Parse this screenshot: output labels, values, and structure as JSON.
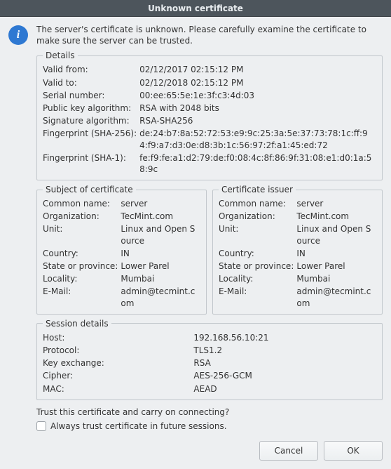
{
  "title": "Unknown certificate",
  "message": "The server's certificate is unknown. Please carefully examine the certificate to make sure the server can be trusted.",
  "details": {
    "legend": "Details",
    "valid_from_label": "Valid from:",
    "valid_from": "02/12/2017 02:15:12 PM",
    "valid_to_label": "Valid to:",
    "valid_to": "02/12/2018 02:15:12 PM",
    "serial_label": "Serial number:",
    "serial": "00:ee:65:5e:1e:3f:c3:4d:03",
    "pubkey_label": "Public key algorithm:",
    "pubkey": "RSA with 2048 bits",
    "sigalg_label": "Signature algorithm:",
    "sigalg": "RSA-SHA256",
    "fp256_label": "Fingerprint (SHA-256):",
    "fp256": "de:24:b7:8a:52:72:53:e9:9c:25:3a:5e:37:73:78:1c:ff:94:f9:a7:d3:0e:d8:3b:1c:56:97:2f:a1:45:ed:72",
    "fp1_label": "Fingerprint (SHA-1):",
    "fp1": "fe:f9:fe:a1:d2:79:de:f0:08:4c:8f:86:9f:31:08:e1:d0:1a:58:9c"
  },
  "subject": {
    "legend": "Subject of certificate",
    "cn_label": "Common name:",
    "cn": "server",
    "org_label": "Organization:",
    "org": "TecMint.com",
    "unit_label": "Unit:",
    "unit": "Linux and Open Source",
    "country_label": "Country:",
    "country": "IN",
    "state_label": "State or province:",
    "state": "Lower Parel",
    "locality_label": "Locality:",
    "locality": "Mumbai",
    "email_label": "E-Mail:",
    "email": "admin@tecmint.com"
  },
  "issuer": {
    "legend": "Certificate issuer",
    "cn_label": "Common name:",
    "cn": "server",
    "org_label": "Organization:",
    "org": "TecMint.com",
    "unit_label": "Unit:",
    "unit": "Linux and Open Source",
    "country_label": "Country:",
    "country": "IN",
    "state_label": "State or province:",
    "state": "Lower Parel",
    "locality_label": "Locality:",
    "locality": "Mumbai",
    "email_label": "E-Mail:",
    "email": "admin@tecmint.com"
  },
  "session": {
    "legend": "Session details",
    "host_label": "Host:",
    "host": "192.168.56.10:21",
    "protocol_label": "Protocol:",
    "protocol": "TLS1.2",
    "kex_label": "Key exchange:",
    "kex": "RSA",
    "cipher_label": "Cipher:",
    "cipher": "AES-256-GCM",
    "mac_label": "MAC:",
    "mac": "AEAD"
  },
  "question": "Trust this certificate and carry on connecting?",
  "checkbox_label": "Always trust certificate in future sessions.",
  "buttons": {
    "cancel": "Cancel",
    "ok": "OK"
  }
}
